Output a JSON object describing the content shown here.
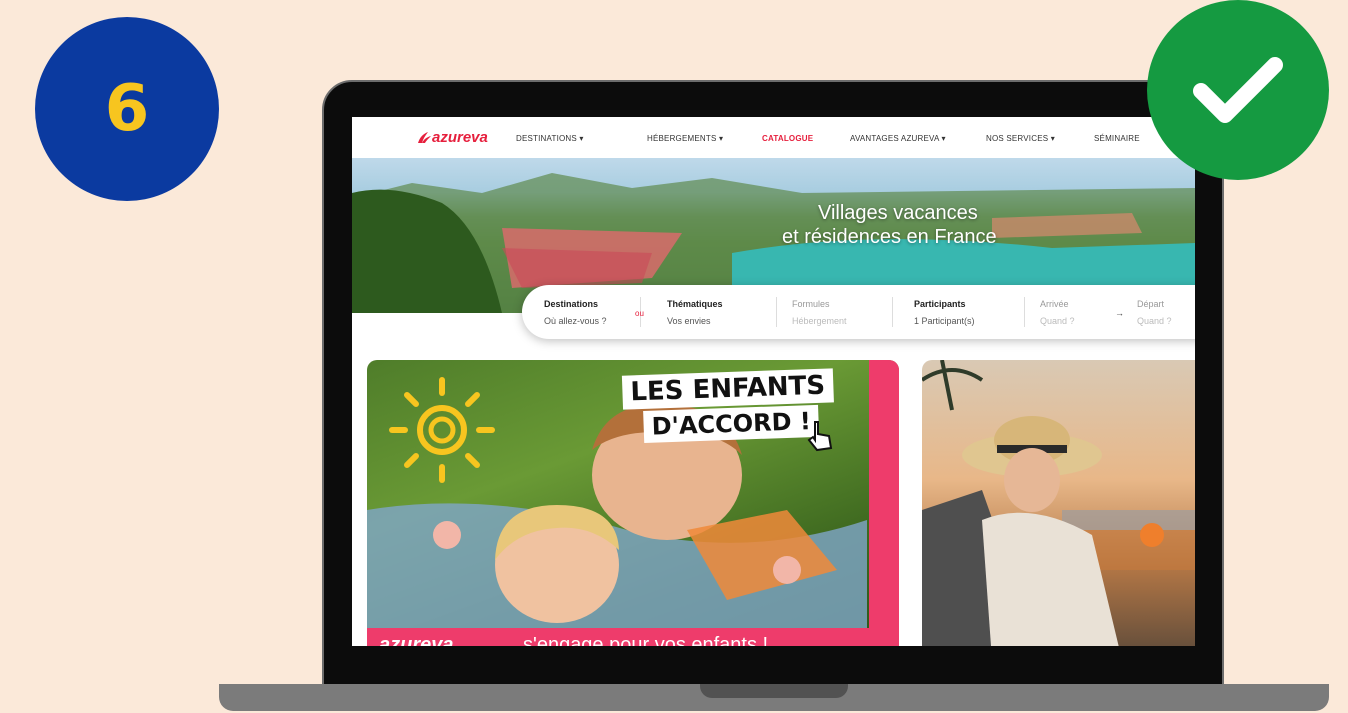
{
  "badge": {
    "number": "6"
  },
  "nav": {
    "logo": "azureva",
    "items": [
      {
        "label": "DESTINATIONS",
        "has_caret": true
      },
      {
        "label": "HÉBERGEMENTS",
        "has_caret": true
      },
      {
        "label": "CATALOGUE",
        "active": true
      },
      {
        "label": "AVANTAGES AZUREVA",
        "has_caret": true
      },
      {
        "label": "NOS SERVICES",
        "has_caret": true
      },
      {
        "label": "SÉMINAIRE"
      }
    ],
    "caret": "▾"
  },
  "hero": {
    "line1": "Villages vacances",
    "line2": "et résidences en France"
  },
  "search": {
    "destinations": {
      "label": "Destinations",
      "value": "Où allez-vous ?"
    },
    "or": "ou",
    "thematiques": {
      "label": "Thématiques",
      "value": "Vos envies"
    },
    "formules": {
      "label": "Formules",
      "value": "Hébergement"
    },
    "participants": {
      "label": "Participants",
      "value": "1 Participant(s)"
    },
    "arrivee": {
      "label": "Arrivée",
      "value": "Quand ?"
    },
    "arrow": "→",
    "depart": {
      "label": "Départ",
      "value": "Quand ?"
    }
  },
  "card1": {
    "title_line1": "LES ENFANTS",
    "title_line2": "D'ACCORD !",
    "brand": "azureva",
    "tagline": "s'engage pour vos enfants !"
  },
  "colors": {
    "brand_red": "#e61f3d",
    "pink": "#ee3c6b",
    "badge_blue": "#0b3aa0",
    "badge_yellow": "#f7c51f",
    "check_green": "#159a41",
    "background": "#fbe9d9"
  }
}
